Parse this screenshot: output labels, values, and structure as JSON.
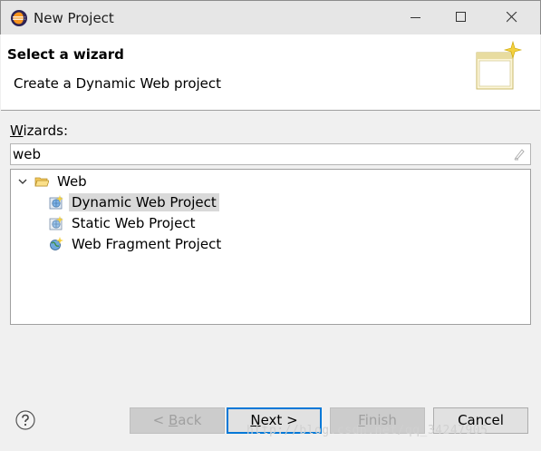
{
  "window": {
    "title": "New Project",
    "app_icon": "eclipse-icon"
  },
  "header": {
    "title": "Select a wizard",
    "description": "Create a Dynamic Web project",
    "banner_icon": "new-wizard-banner-icon"
  },
  "wizards": {
    "label_prefix": "W",
    "label_rest": "izards:",
    "filter_value": "web",
    "tree": [
      {
        "label": "Web",
        "type": "folder",
        "expanded": true
      },
      {
        "label": "Dynamic Web Project",
        "type": "item",
        "selected": true
      },
      {
        "label": "Static Web Project",
        "type": "item",
        "selected": false
      },
      {
        "label": "Web Fragment Project",
        "type": "item",
        "selected": false
      }
    ]
  },
  "buttons": {
    "back_prefix": "< ",
    "back_acc": "B",
    "back_rest": "ack",
    "next_acc": "N",
    "next_rest": "ext >",
    "finish_acc": "F",
    "finish_rest": "inish",
    "cancel": "Cancel"
  },
  "watermark": "http://blog.csdn.net/qq_34247905",
  "colors": {
    "accent": "#0078d7",
    "selection": "#d9d9d9",
    "header_bg": "#ffffff",
    "dialog_bg": "#f0f0f0"
  }
}
